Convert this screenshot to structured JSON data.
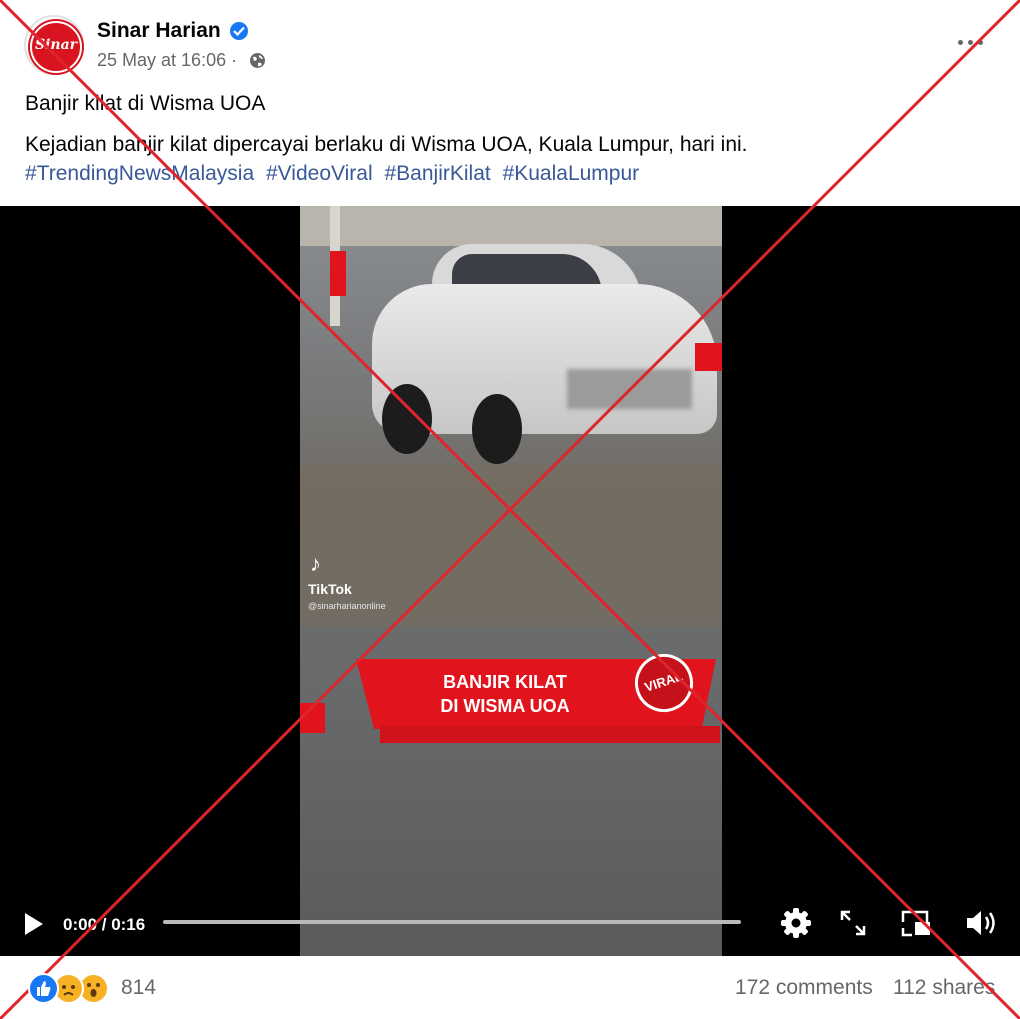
{
  "post": {
    "page_name": "Sinar Harian",
    "avatar_text": "Sinar",
    "timestamp": "25 May at 16:06 ·",
    "title": "Banjir kilat di Wisma UOA",
    "body": "Kejadian banjir kilat dipercayai berlaku di Wisma UOA, Kuala Lumpur, hari ini.",
    "hashtags": [
      "#TrendingNewsMalaysia",
      "#VideoViral",
      "#BanjirKilat",
      "#KualaLumpur"
    ]
  },
  "video": {
    "tiktok_label": "TikTok",
    "tiktok_handle": "@sinarharianonline",
    "banner_line1": "BANJIR KILAT",
    "banner_line2": "DI WISMA UOA",
    "stamp_text": "VIRAL",
    "time": "0:00 / 0:16",
    "progress_fraction": 0.0
  },
  "footer": {
    "reaction_count": "814",
    "comments": "172 comments",
    "shares": "112 shares"
  },
  "colors": {
    "brand_red": "#e1141e",
    "link_blue": "#385898",
    "facebook_blue": "#1877f2",
    "cross_red": "#e0242b"
  },
  "icons": [
    "verified-icon",
    "globe-icon",
    "more-icon",
    "play-icon",
    "settings-icon",
    "fullscreen-icon",
    "pip-icon",
    "volume-icon",
    "like-icon",
    "sad-icon",
    "wow-icon"
  ]
}
